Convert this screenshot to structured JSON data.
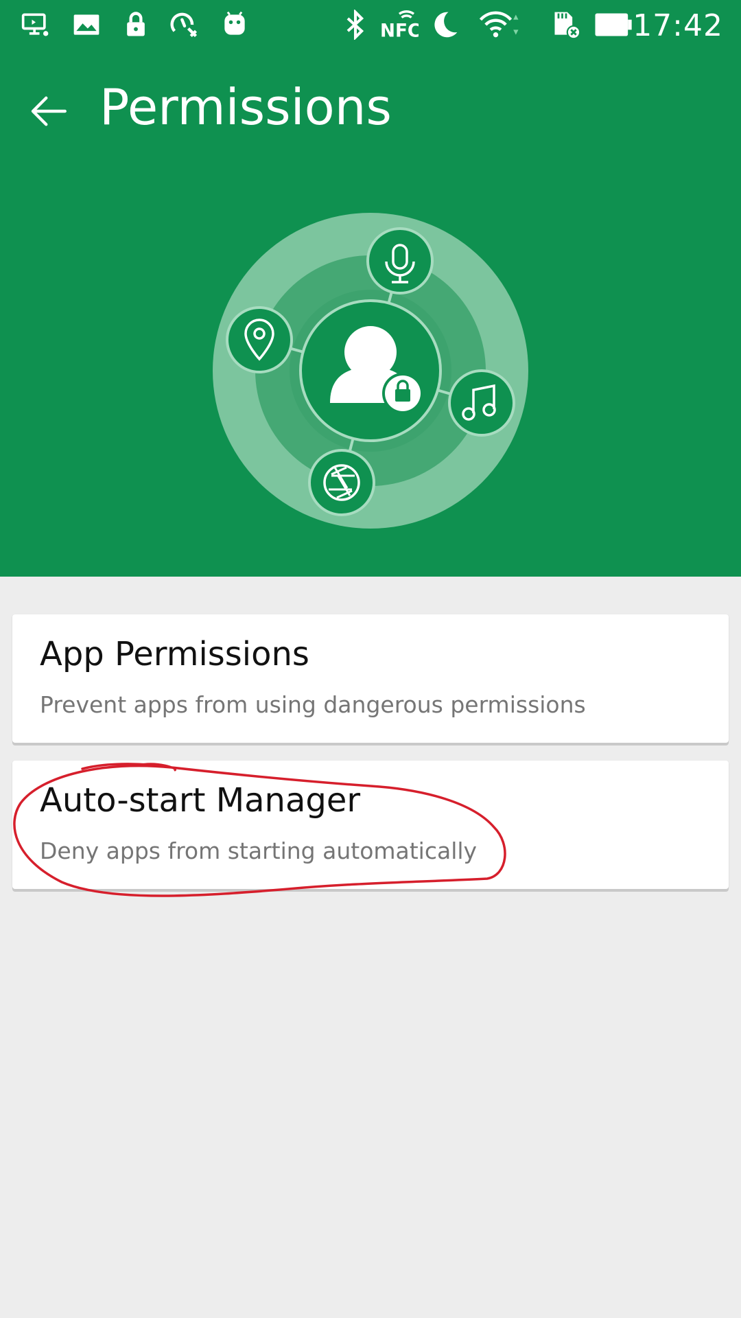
{
  "status_bar": {
    "time": "17:42",
    "left_icons": [
      "screen-cast-icon",
      "image-icon",
      "lock-icon",
      "speedometer-tool-icon",
      "android-icon"
    ],
    "right_icons": [
      "bluetooth-icon",
      "nfc-icon",
      "moon-icon",
      "wifi-icon",
      "sd-card-icon",
      "battery-icon"
    ],
    "nfc_label": "NFC"
  },
  "app_bar": {
    "title": "Permissions",
    "back_icon": "arrow-left-icon"
  },
  "hero": {
    "icons": [
      "user-lock-icon",
      "microphone-icon",
      "location-pin-icon",
      "music-note-icon",
      "camera-aperture-icon"
    ]
  },
  "cards": [
    {
      "title": "App Permissions",
      "subtitle": "Prevent apps from using dangerous permissions"
    },
    {
      "title": "Auto-start Manager",
      "subtitle": "Deny apps from starting automatically"
    }
  ],
  "colors": {
    "primary": "#0f9150",
    "background": "#ededed",
    "card": "#ffffff",
    "annotation": "#d61f2c"
  }
}
